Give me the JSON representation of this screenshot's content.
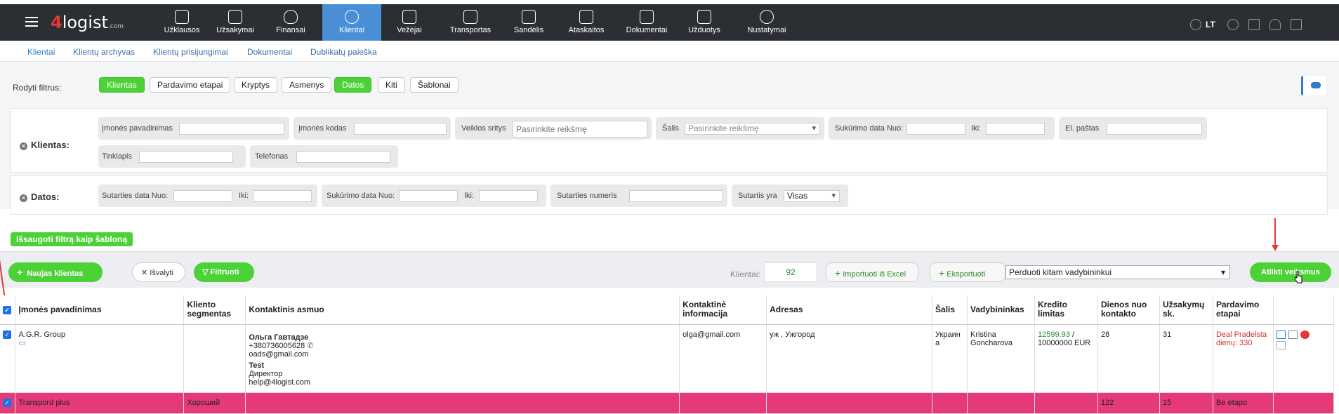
{
  "nav": {
    "logo": "4logist",
    "logo_suffix": ".com",
    "items": [
      {
        "label": "Užklausos",
        "icon": "question-icon"
      },
      {
        "label": "Užsakymai",
        "icon": "box-icon"
      },
      {
        "label": "Finansai",
        "icon": "money-bag-icon"
      },
      {
        "label": "Klientai",
        "icon": "users-icon",
        "active": true
      },
      {
        "label": "Vežėjai",
        "icon": "truck-icon"
      },
      {
        "label": "Transportas",
        "icon": "car-icon"
      },
      {
        "label": "Sandėlis",
        "icon": "warehouse-icon"
      },
      {
        "label": "Ataskaitos",
        "icon": "calculator-icon"
      },
      {
        "label": "Dokumentai",
        "icon": "document-icon"
      },
      {
        "label": "Užduotys",
        "icon": "calendar-icon"
      },
      {
        "label": "Nustatymai",
        "icon": "gear-icon"
      }
    ],
    "lang": "LT"
  },
  "subnav": [
    "Klientai",
    "Klientų archyvas",
    "Klientų prisijungimai",
    "Dokumentai",
    "Dublikatų paieška"
  ],
  "filters": {
    "show_label": "Rodyti filtrus:",
    "chips": [
      {
        "label": "Klientas",
        "active": true
      },
      {
        "label": "Pardavimo etapai",
        "active": false
      },
      {
        "label": "Kryptys",
        "active": false
      },
      {
        "label": "Asmenys",
        "active": false
      },
      {
        "label": "Datos",
        "active": true
      },
      {
        "label": "Kiti",
        "active": false
      },
      {
        "label": "Šablonai",
        "active": false
      }
    ],
    "klientas_section": "Klientas:",
    "datos_section": "Datos:",
    "f_imones_pav": "Įmonės pavadinimas",
    "f_imones_kodas": "Įmonės kodas",
    "f_veiklos": "Veiklos sritys",
    "f_veiklos_ph": "Pasirinkite reikšmę",
    "f_salis": "Šalis",
    "f_salis_ph": "Pasirinkite reikšmę",
    "f_sukurimo_nuo": "Sukūrimo data Nuo:",
    "f_iki": "Iki:",
    "f_email": "El. paštas",
    "f_tinklapis": "Tinklapis",
    "f_telefonas": "Telefonas",
    "f_sutarties_nuo": "Sutarties data Nuo:",
    "f_sutarties_numeris": "Sutarties numeris",
    "f_sutartis_yra": "Sutartis yra",
    "f_sutartis_val": "Visas",
    "save_template": "Išsaugoti filtrą kaip šabloną"
  },
  "actions": {
    "new_client": "Naujas klientas",
    "clear": "Išvalyti",
    "filter": "Filtruoti",
    "clients_label": "Klientai:",
    "clients_count": "92",
    "import": "Importuoti iš Excel",
    "export": "Eksportuoti",
    "transfer": "Perduoti kitam vadybininkui",
    "execute": "Atlikti veiksmus"
  },
  "table": {
    "headers": [
      "Įmonės pavadinimas",
      "Kliento segmentas",
      "Kontaktinis asmuo",
      "Kontaktinė informacija",
      "Adresas",
      "Šalis",
      "Vadybininkas",
      "Kredito limitas",
      "Dienos nuo kontakto",
      "Užsakymų sk.",
      "Pardavimo etapai"
    ],
    "row1": {
      "company": "A.G.R. Group",
      "contact1_name": "Ольга Гавтадзе",
      "contact1_phone": "+380736005628",
      "contact1_email": "oads@gmail.com",
      "contact2_name": "Test",
      "contact2_title": "Директор",
      "contact2_email": "help@4logist.com",
      "email": "olga@gmail.com",
      "address": "уж , Ужгород",
      "country": "Украина",
      "manager": "Kristina Goncharova",
      "credit_used": "12599.93",
      "credit_limit": "/ 10000000 EUR",
      "days": "28",
      "orders": "31",
      "stage": "Deal Pradelsta dienų: 330"
    },
    "row2": {
      "company": "Transpord plus",
      "segment": "Хороший",
      "days": "122",
      "orders": "15",
      "stage": "Be etapo"
    }
  },
  "colors": {
    "accent_green": "#4cd137",
    "nav_bg": "#2b2e33",
    "nav_active": "#4a8fd6",
    "row_highlight": "#e6397a"
  }
}
